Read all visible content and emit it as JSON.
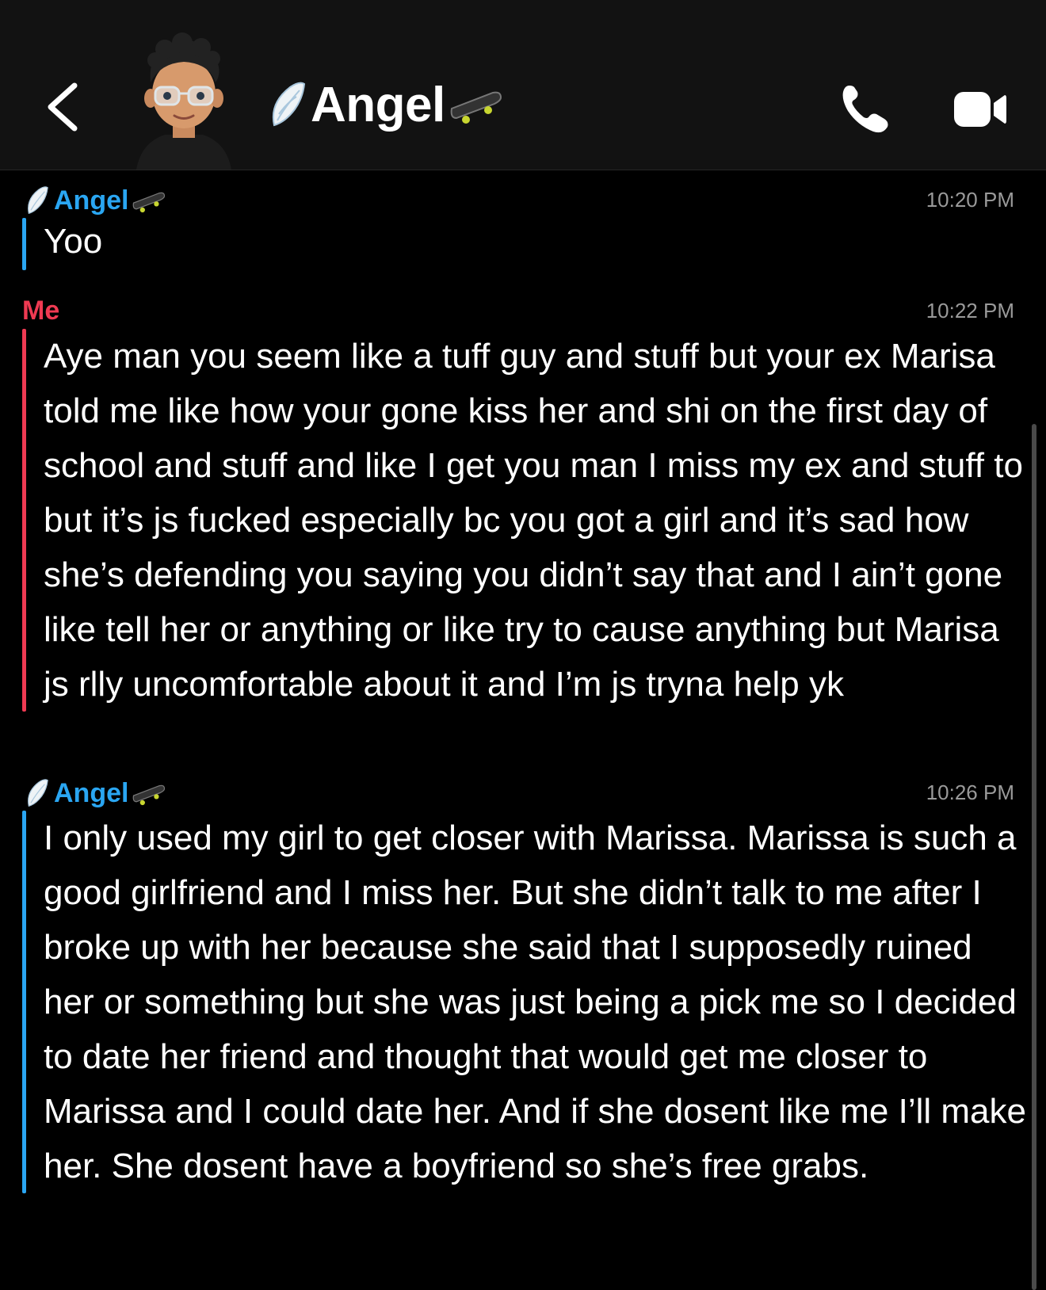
{
  "header": {
    "title": "Angel",
    "back_icon": "chevron-left-icon",
    "call_icon": "phone-icon",
    "video_icon": "video-camera-icon",
    "title_prefix_icon": "angel-wing-emoji",
    "title_suffix_icon": "skateboard-emoji"
  },
  "colors": {
    "them": "#2aa6f2",
    "me": "#ef3a52",
    "timestamp": "#9a9a9a"
  },
  "messages": [
    {
      "sender": "Angel",
      "time": "10:20 PM",
      "text": "Yoo"
    },
    {
      "sender": "Me",
      "time": "10:22 PM",
      "text": "Aye man you seem like a tuff guy and stuff but your ex Marisa told me like how your gone kiss her and shi on the first day of school and stuff and like I get you man I miss my ex and stuff to but it’s js fucked especially bc you got a girl and it’s sad how she’s defending you saying you didn’t say that and I ain’t gone like tell her or anything or like try to cause anything but Marisa js rlly uncomfortable about it and I’m js tryna help yk"
    },
    {
      "sender": "Angel",
      "time": "10:26 PM",
      "text": "I only used my girl to get closer with Marissa. Marissa is such a good girlfriend and I miss her. But she didn’t talk to me after I broke up with her because she said that I supposedly ruined her or something but she was just being a pick me so I decided to date her friend and thought that would get me closer to Marissa and I could date her. And if she dosent like me I’ll make her. She dosent have a boyfriend so she’s free grabs."
    }
  ]
}
